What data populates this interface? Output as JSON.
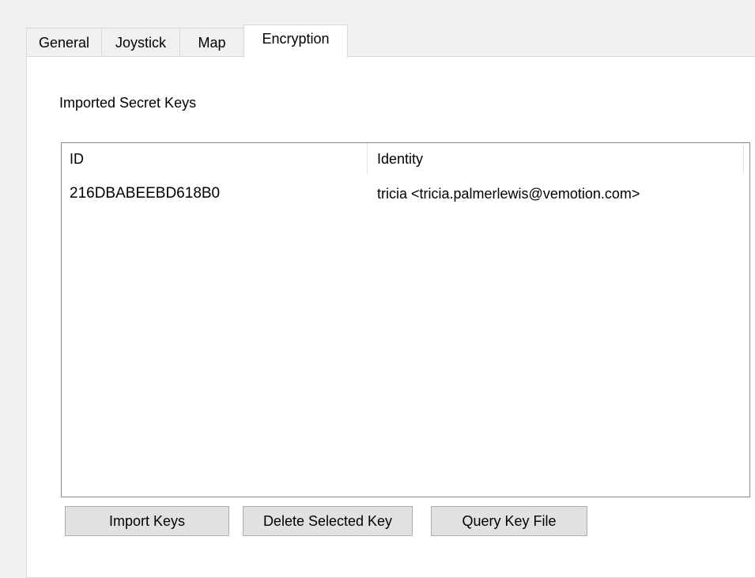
{
  "tabs": [
    {
      "label": "General"
    },
    {
      "label": "Joystick"
    },
    {
      "label": "Map"
    },
    {
      "label": "Encryption",
      "active": true
    }
  ],
  "encryption": {
    "section_label": "Imported Secret Keys",
    "list": {
      "columns": [
        "ID",
        "Identity"
      ],
      "rows": [
        {
          "id": "216DBABEEBD618B0",
          "identity": "tricia <tricia.palmerlewis@vemotion.com>"
        }
      ]
    },
    "buttons": {
      "import": "Import Keys",
      "delete": "Delete Selected Key",
      "query": "Query Key File"
    }
  },
  "colors": {
    "window_bg": "#f0f0f0",
    "panel_bg": "#ffffff",
    "button_bg": "#e1e1e1",
    "button_border": "#adadad",
    "tab_border": "#d9d9d9"
  }
}
